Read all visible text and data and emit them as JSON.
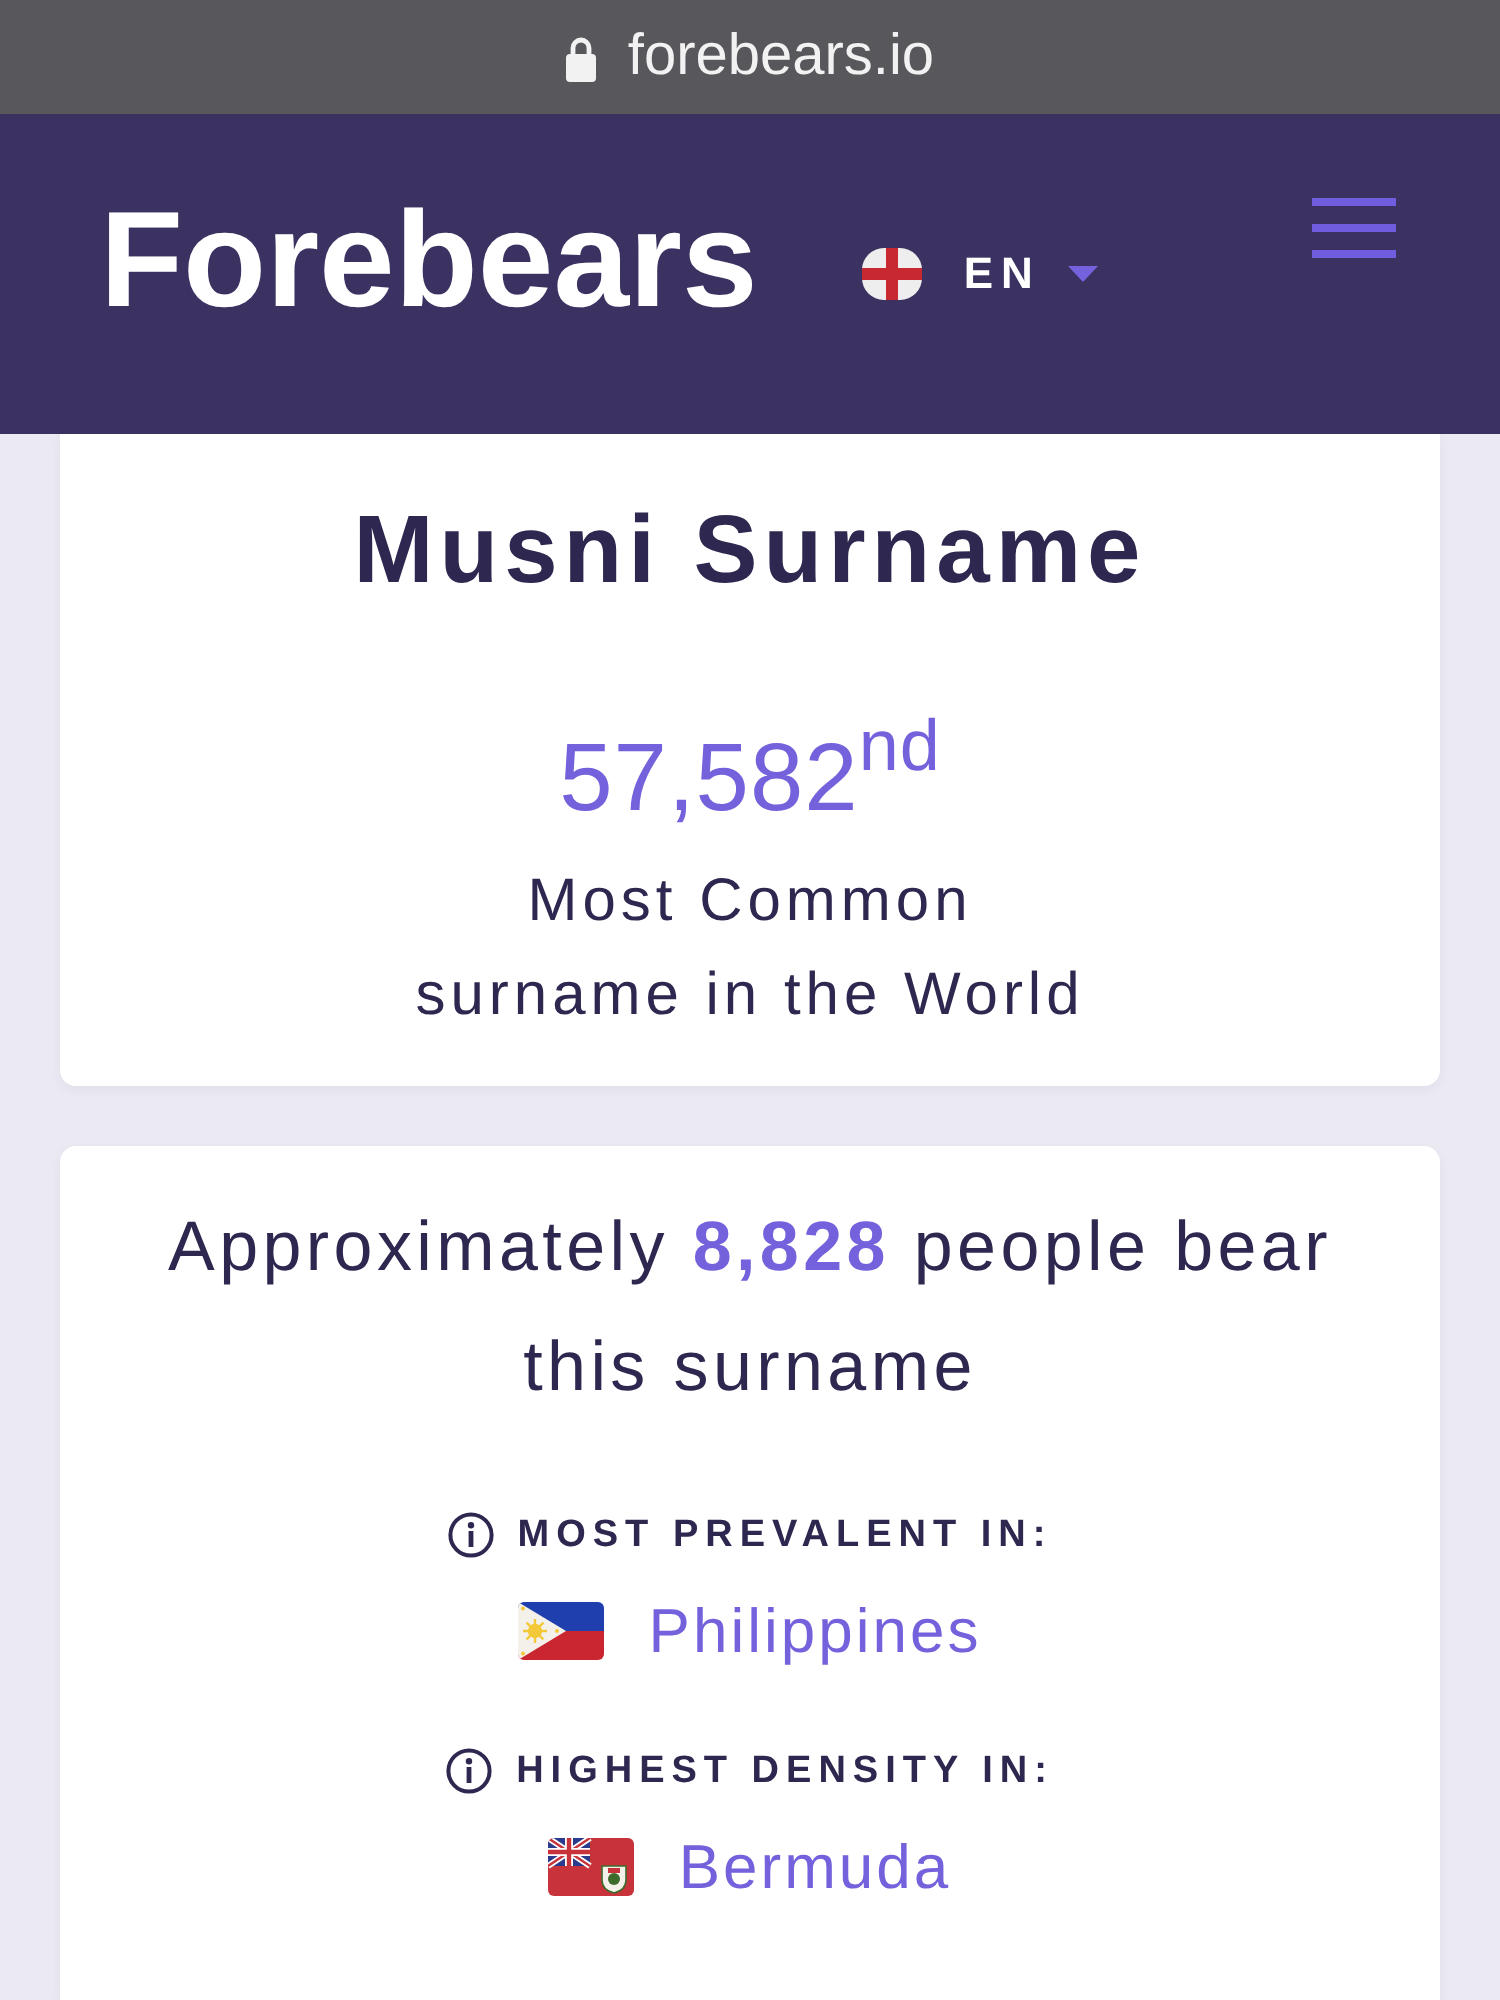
{
  "browser_bar": {
    "url": "forebears.io"
  },
  "navbar": {
    "brand": "Forebears",
    "language": "EN"
  },
  "rank_card": {
    "title": "Musni Surname",
    "rank": "57,582$^{nd}$",
    "caption_lines": [
      "Most Common",
      "surname in the World"
    ]
  },
  "population_card": {
    "summary": "Approximately **8,828** people bear this surname",
    "facts": [
      {
        "label": "MOST PREVALENT IN:",
        "country": "Philippines",
        "kind": "philippines"
      },
      {
        "label": "HIGHEST DENSITY IN:",
        "country": "Bermuda",
        "kind": "bermuda"
      }
    ]
  }
}
